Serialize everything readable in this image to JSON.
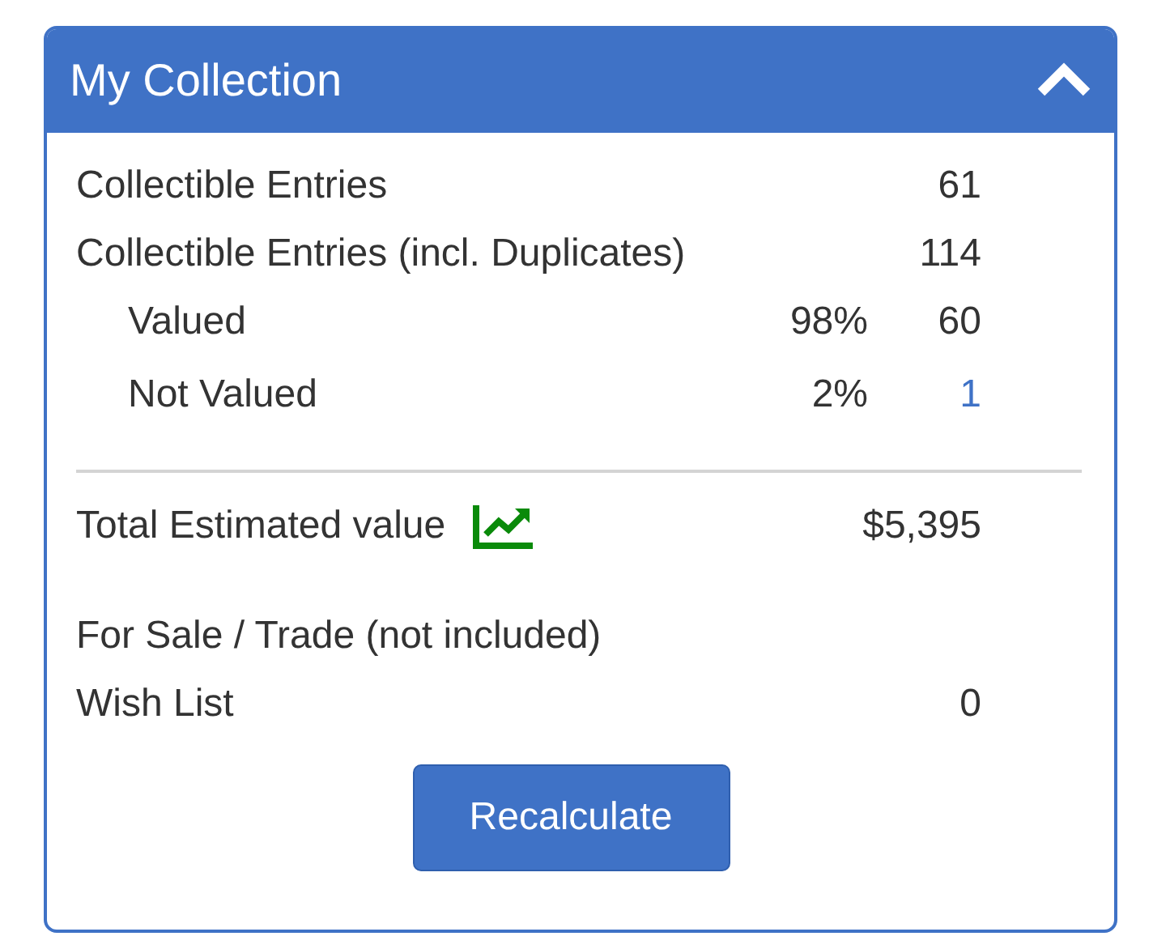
{
  "panel": {
    "title": "My Collection",
    "expanded": true
  },
  "stats": [
    {
      "label": "Collectible Entries",
      "indent": false,
      "count": "61",
      "count_link": false
    },
    {
      "label": "Collectible Entries (incl. Duplicates)",
      "indent": false,
      "count": "114",
      "count_link": false
    },
    {
      "label": "Valued",
      "indent": true,
      "percent": "98%",
      "count": "60",
      "count_link": false
    },
    {
      "label": "Not Valued",
      "indent": true,
      "percent": "2%",
      "count": "1",
      "count_link": true
    }
  ],
  "total": {
    "label": "Total Estimated value",
    "value": "$5,395"
  },
  "extras": [
    {
      "label": "For Sale / Trade (not included)"
    },
    {
      "label": "Wish List",
      "count": "0"
    }
  ],
  "button": "Recalculate"
}
